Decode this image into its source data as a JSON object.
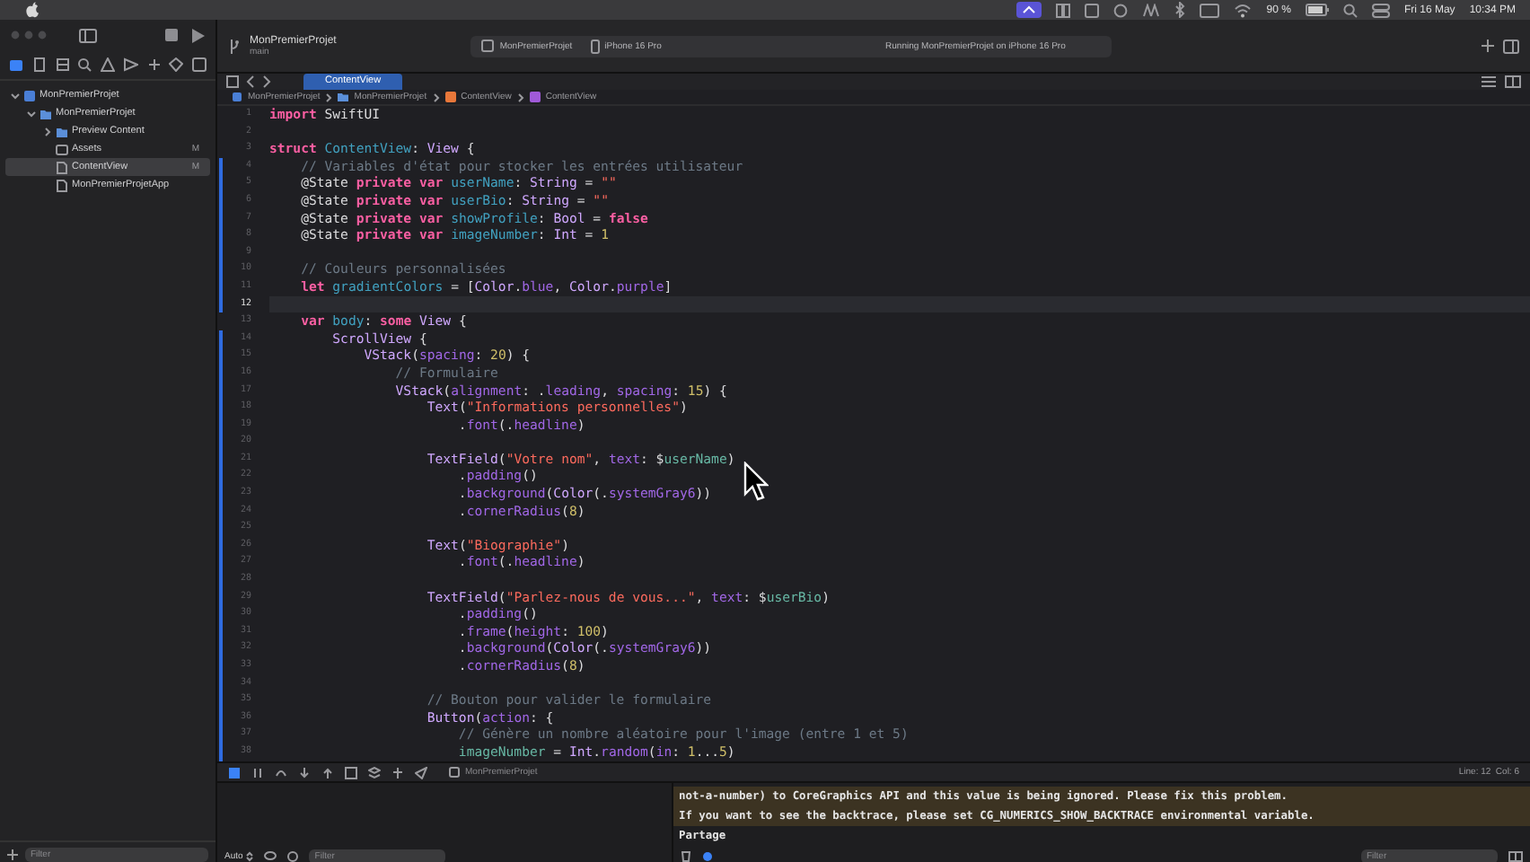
{
  "menu_bar": {
    "battery": "90 %",
    "date": "Fri 16 May",
    "time": "10:34 PM"
  },
  "toolbar": {
    "project": "MonPremierProjet",
    "branch": "main",
    "scheme": "MonPremierProjet",
    "destination": "iPhone 16 Pro",
    "status": "Running MonPremierProjet on iPhone 16 Pro"
  },
  "navigator": {
    "tree": [
      {
        "label": "MonPremierProjet",
        "kind": "project",
        "expanded": true,
        "selected": false,
        "children": [
          {
            "label": "MonPremierProjet",
            "kind": "folder",
            "expanded": true,
            "selected": false,
            "children": [
              {
                "label": "Preview Content",
                "kind": "folder",
                "expanded": false,
                "selected": false
              },
              {
                "label": "Assets",
                "kind": "assets",
                "badge": "M",
                "selected": false
              },
              {
                "label": "ContentView",
                "kind": "swift",
                "badge": "M",
                "selected": true
              },
              {
                "label": "MonPremierProjetApp",
                "kind": "swift",
                "selected": false
              }
            ]
          }
        ]
      }
    ],
    "filter_placeholder": "Filter"
  },
  "editor": {
    "tabs": [
      {
        "label": "ContentView",
        "selected": true
      }
    ],
    "breadcrumb": [
      {
        "label": "MonPremierProjet",
        "kind": "project"
      },
      {
        "label": "MonPremierProjet",
        "kind": "folder"
      },
      {
        "label": "ContentView",
        "kind": "swift"
      },
      {
        "label": "ContentView",
        "kind": "struct"
      }
    ],
    "lines": [
      {
        "number": "1",
        "changed": false,
        "current": false,
        "tokens": [
          {
            "kind": "keyword",
            "text": "import"
          },
          {
            "kind": "plain",
            "text": " SwiftUI"
          }
        ]
      },
      {
        "number": "2",
        "changed": false,
        "current": false
      },
      {
        "number": "3",
        "changed": false,
        "current": false,
        "tokens": [
          {
            "kind": "keyword",
            "text": "struct"
          },
          {
            "kind": "declaration",
            "text": " ContentView"
          },
          {
            "kind": "plain",
            "text": ": "
          },
          {
            "kind": "type",
            "text": "View"
          },
          {
            "kind": "plain",
            "text": " {"
          }
        ]
      },
      {
        "number": "4",
        "changed": true,
        "current": false,
        "tokens": [
          {
            "kind": "comment",
            "text": "    // Variables d'état pour stocker les entrées utilisateur"
          }
        ]
      },
      {
        "number": "5",
        "changed": true,
        "current": false,
        "tokens": [
          {
            "kind": "plain",
            "text": "    @State "
          },
          {
            "kind": "keyword",
            "text": "private"
          },
          {
            "kind": "keyword",
            "text": " var"
          },
          {
            "kind": "declaration",
            "text": " userName"
          },
          {
            "kind": "plain",
            "text": ": "
          },
          {
            "kind": "type",
            "text": "String"
          },
          {
            "kind": "plain",
            "text": " = "
          },
          {
            "kind": "string",
            "text": "\"\""
          }
        ]
      },
      {
        "number": "6",
        "changed": true,
        "current": false,
        "tokens": [
          {
            "kind": "plain",
            "text": "    @State "
          },
          {
            "kind": "keyword",
            "text": "private"
          },
          {
            "kind": "keyword",
            "text": " var"
          },
          {
            "kind": "declaration",
            "text": " userBio"
          },
          {
            "kind": "plain",
            "text": ": "
          },
          {
            "kind": "type",
            "text": "String"
          },
          {
            "kind": "plain",
            "text": " = "
          },
          {
            "kind": "string",
            "text": "\"\""
          }
        ]
      },
      {
        "number": "7",
        "changed": true,
        "current": false,
        "tokens": [
          {
            "kind": "plain",
            "text": "    @State "
          },
          {
            "kind": "keyword",
            "text": "private"
          },
          {
            "kind": "keyword",
            "text": " var"
          },
          {
            "kind": "declaration",
            "text": " showProfile"
          },
          {
            "kind": "plain",
            "text": ": "
          },
          {
            "kind": "type",
            "text": "Bool"
          },
          {
            "kind": "plain",
            "text": " = "
          },
          {
            "kind": "keyword",
            "text": "false"
          }
        ]
      },
      {
        "number": "8",
        "changed": true,
        "current": false,
        "tokens": [
          {
            "kind": "plain",
            "text": "    @State "
          },
          {
            "kind": "keyword",
            "text": "private"
          },
          {
            "kind": "keyword",
            "text": " var"
          },
          {
            "kind": "declaration",
            "text": " imageNumber"
          },
          {
            "kind": "plain",
            "text": ": "
          },
          {
            "kind": "type",
            "text": "Int"
          },
          {
            "kind": "plain",
            "text": " = "
          },
          {
            "kind": "number",
            "text": "1"
          }
        ]
      },
      {
        "number": "9",
        "changed": true,
        "current": false
      },
      {
        "number": "10",
        "changed": true,
        "current": false,
        "tokens": [
          {
            "kind": "comment",
            "text": "    // Couleurs personnalisées"
          }
        ]
      },
      {
        "number": "11",
        "changed": true,
        "current": false,
        "tokens": [
          {
            "kind": "keyword",
            "text": "    let"
          },
          {
            "kind": "declaration",
            "text": " gradientColors"
          },
          {
            "kind": "plain",
            "text": " = ["
          },
          {
            "kind": "type",
            "text": "Color"
          },
          {
            "kind": "plain",
            "text": "."
          },
          {
            "kind": "member",
            "text": "blue"
          },
          {
            "kind": "plain",
            "text": ", "
          },
          {
            "kind": "type",
            "text": "Color"
          },
          {
            "kind": "plain",
            "text": "."
          },
          {
            "kind": "member",
            "text": "purple"
          },
          {
            "kind": "plain",
            "text": "]"
          }
        ]
      },
      {
        "number": "12",
        "changed": true,
        "current": true
      },
      {
        "number": "13",
        "changed": false,
        "current": false,
        "tokens": [
          {
            "kind": "keyword",
            "text": "    var"
          },
          {
            "kind": "declaration",
            "text": " body"
          },
          {
            "kind": "plain",
            "text": ": "
          },
          {
            "kind": "keyword",
            "text": "some"
          },
          {
            "kind": "type",
            "text": " View"
          },
          {
            "kind": "plain",
            "text": " {"
          }
        ]
      },
      {
        "number": "14",
        "changed": true,
        "current": false,
        "tokens": [
          {
            "kind": "type",
            "text": "        ScrollView"
          },
          {
            "kind": "plain",
            "text": " {"
          }
        ]
      },
      {
        "number": "15",
        "changed": true,
        "current": false,
        "tokens": [
          {
            "kind": "type",
            "text": "            VStack"
          },
          {
            "kind": "plain",
            "text": "("
          },
          {
            "kind": "member",
            "text": "spacing"
          },
          {
            "kind": "plain",
            "text": ": "
          },
          {
            "kind": "number",
            "text": "20"
          },
          {
            "kind": "plain",
            "text": ") {"
          }
        ]
      },
      {
        "number": "16",
        "changed": true,
        "current": false,
        "tokens": [
          {
            "kind": "comment",
            "text": "                // Formulaire"
          }
        ]
      },
      {
        "number": "17",
        "changed": true,
        "current": false,
        "tokens": [
          {
            "kind": "type",
            "text": "                VStack"
          },
          {
            "kind": "plain",
            "text": "("
          },
          {
            "kind": "member",
            "text": "alignment"
          },
          {
            "kind": "plain",
            "text": ": ."
          },
          {
            "kind": "member",
            "text": "leading"
          },
          {
            "kind": "plain",
            "text": ", "
          },
          {
            "kind": "member",
            "text": "spacing"
          },
          {
            "kind": "plain",
            "text": ": "
          },
          {
            "kind": "number",
            "text": "15"
          },
          {
            "kind": "plain",
            "text": ") {"
          }
        ]
      },
      {
        "number": "18",
        "changed": true,
        "current": false,
        "tokens": [
          {
            "kind": "type",
            "text": "                    Text"
          },
          {
            "kind": "plain",
            "text": "("
          },
          {
            "kind": "string",
            "text": "\"Informations personnelles\""
          },
          {
            "kind": "plain",
            "text": ")"
          }
        ]
      },
      {
        "number": "19",
        "changed": true,
        "current": false,
        "tokens": [
          {
            "kind": "plain",
            "text": "                        ."
          },
          {
            "kind": "member",
            "text": "font"
          },
          {
            "kind": "plain",
            "text": "(."
          },
          {
            "kind": "member",
            "text": "headline"
          },
          {
            "kind": "plain",
            "text": ")"
          }
        ]
      },
      {
        "number": "20",
        "changed": true,
        "current": false
      },
      {
        "number": "21",
        "changed": true,
        "current": false,
        "tokens": [
          {
            "kind": "type",
            "text": "                    TextField"
          },
          {
            "kind": "plain",
            "text": "("
          },
          {
            "kind": "string",
            "text": "\"Votre nom\""
          },
          {
            "kind": "plain",
            "text": ", "
          },
          {
            "kind": "member",
            "text": "text"
          },
          {
            "kind": "plain",
            "text": ": $"
          },
          {
            "kind": "property",
            "text": "userName"
          },
          {
            "kind": "plain",
            "text": ")"
          }
        ]
      },
      {
        "number": "22",
        "changed": true,
        "current": false,
        "tokens": [
          {
            "kind": "plain",
            "text": "                        ."
          },
          {
            "kind": "member",
            "text": "padding"
          },
          {
            "kind": "plain",
            "text": "()"
          }
        ]
      },
      {
        "number": "23",
        "changed": true,
        "current": false,
        "tokens": [
          {
            "kind": "plain",
            "text": "                        ."
          },
          {
            "kind": "member",
            "text": "background"
          },
          {
            "kind": "plain",
            "text": "("
          },
          {
            "kind": "type",
            "text": "Color"
          },
          {
            "kind": "plain",
            "text": "(."
          },
          {
            "kind": "member",
            "text": "systemGray6"
          },
          {
            "kind": "plain",
            "text": "))"
          }
        ]
      },
      {
        "number": "24",
        "changed": true,
        "current": false,
        "tokens": [
          {
            "kind": "plain",
            "text": "                        ."
          },
          {
            "kind": "member",
            "text": "cornerRadius"
          },
          {
            "kind": "plain",
            "text": "("
          },
          {
            "kind": "number",
            "text": "8"
          },
          {
            "kind": "plain",
            "text": ")"
          }
        ]
      },
      {
        "number": "25",
        "changed": true,
        "current": false
      },
      {
        "number": "26",
        "changed": true,
        "current": false,
        "tokens": [
          {
            "kind": "type",
            "text": "                    Text"
          },
          {
            "kind": "plain",
            "text": "("
          },
          {
            "kind": "string",
            "text": "\"Biographie\""
          },
          {
            "kind": "plain",
            "text": ")"
          }
        ]
      },
      {
        "number": "27",
        "changed": true,
        "current": false,
        "tokens": [
          {
            "kind": "plain",
            "text": "                        ."
          },
          {
            "kind": "member",
            "text": "font"
          },
          {
            "kind": "plain",
            "text": "(."
          },
          {
            "kind": "member",
            "text": "headline"
          },
          {
            "kind": "plain",
            "text": ")"
          }
        ]
      },
      {
        "number": "28",
        "changed": true,
        "current": false
      },
      {
        "number": "29",
        "changed": true,
        "current": false,
        "tokens": [
          {
            "kind": "type",
            "text": "                    TextField"
          },
          {
            "kind": "plain",
            "text": "("
          },
          {
            "kind": "string",
            "text": "\"Parlez-nous de vous...\""
          },
          {
            "kind": "plain",
            "text": ", "
          },
          {
            "kind": "member",
            "text": "text"
          },
          {
            "kind": "plain",
            "text": ": $"
          },
          {
            "kind": "property",
            "text": "userBio"
          },
          {
            "kind": "plain",
            "text": ")"
          }
        ]
      },
      {
        "number": "30",
        "changed": true,
        "current": false,
        "tokens": [
          {
            "kind": "plain",
            "text": "                        ."
          },
          {
            "kind": "member",
            "text": "padding"
          },
          {
            "kind": "plain",
            "text": "()"
          }
        ]
      },
      {
        "number": "31",
        "changed": true,
        "current": false,
        "tokens": [
          {
            "kind": "plain",
            "text": "                        ."
          },
          {
            "kind": "member",
            "text": "frame"
          },
          {
            "kind": "plain",
            "text": "("
          },
          {
            "kind": "member",
            "text": "height"
          },
          {
            "kind": "plain",
            "text": ": "
          },
          {
            "kind": "number",
            "text": "100"
          },
          {
            "kind": "plain",
            "text": ")"
          }
        ]
      },
      {
        "number": "32",
        "changed": true,
        "current": false,
        "tokens": [
          {
            "kind": "plain",
            "text": "                        ."
          },
          {
            "kind": "member",
            "text": "background"
          },
          {
            "kind": "plain",
            "text": "("
          },
          {
            "kind": "type",
            "text": "Color"
          },
          {
            "kind": "plain",
            "text": "(."
          },
          {
            "kind": "member",
            "text": "systemGray6"
          },
          {
            "kind": "plain",
            "text": "))"
          }
        ]
      },
      {
        "number": "33",
        "changed": true,
        "current": false,
        "tokens": [
          {
            "kind": "plain",
            "text": "                        ."
          },
          {
            "kind": "member",
            "text": "cornerRadius"
          },
          {
            "kind": "plain",
            "text": "("
          },
          {
            "kind": "number",
            "text": "8"
          },
          {
            "kind": "plain",
            "text": ")"
          }
        ]
      },
      {
        "number": "34",
        "changed": true,
        "current": false
      },
      {
        "number": "35",
        "changed": true,
        "current": false,
        "tokens": [
          {
            "kind": "comment",
            "text": "                    // Bouton pour valider le formulaire"
          }
        ]
      },
      {
        "number": "36",
        "changed": true,
        "current": false,
        "tokens": [
          {
            "kind": "type",
            "text": "                    Button"
          },
          {
            "kind": "plain",
            "text": "("
          },
          {
            "kind": "member",
            "text": "action"
          },
          {
            "kind": "plain",
            "text": ": {"
          }
        ]
      },
      {
        "number": "37",
        "changed": true,
        "current": false,
        "tokens": [
          {
            "kind": "comment",
            "text": "                        // Génère un nombre aléatoire pour l'image (entre 1 et 5)"
          }
        ]
      },
      {
        "number": "38",
        "changed": true,
        "current": false,
        "tokens": [
          {
            "kind": "property",
            "text": "                        imageNumber"
          },
          {
            "kind": "plain",
            "text": " = "
          },
          {
            "kind": "type",
            "text": "Int"
          },
          {
            "kind": "plain",
            "text": "."
          },
          {
            "kind": "member",
            "text": "random"
          },
          {
            "kind": "plain",
            "text": "("
          },
          {
            "kind": "member",
            "text": "in"
          },
          {
            "kind": "plain",
            "text": ": "
          },
          {
            "kind": "number",
            "text": "1"
          },
          {
            "kind": "plain",
            "text": "..."
          },
          {
            "kind": "number",
            "text": "5"
          },
          {
            "kind": "plain",
            "text": ")"
          }
        ]
      }
    ]
  },
  "debug": {
    "process": "MonPremierProjet",
    "cursor_position": "Line: 12  Col: 6",
    "scope": "Auto",
    "variables_filter_placeholder": "Filter",
    "console_filter_placeholder": "Filter",
    "console": [
      {
        "text": "not-a-number) to CoreGraphics API and this value is being ignored. Please fix this problem.",
        "kind": "warning"
      },
      {
        "text": "If you want to see the backtrace, please set CG_NUMERICS_SHOW_BACKTRACE environmental variable.",
        "kind": "warning"
      },
      {
        "text": "Partage",
        "kind": "output"
      }
    ]
  }
}
